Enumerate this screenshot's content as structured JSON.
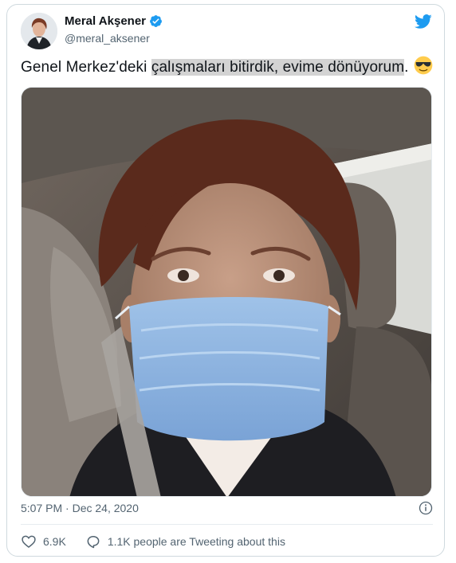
{
  "tweet": {
    "author_name": "Meral Akşener",
    "author_handle": "@meral_aksener",
    "text_before": "Genel Merkez'deki ",
    "text_highlight": "çalışmaları bitirdik, evime dönüyorum",
    "text_after": ".",
    "emoji": "smiling-face-with-sunglasses",
    "timestamp": "5:07 PM · Dec 24, 2020",
    "likes": "6.9K",
    "retweet_label": "1.1K people are Tweeting about this"
  },
  "colors": {
    "twitter_blue": "#1d9bf0",
    "text": "#0f1419",
    "secondary": "#536471",
    "border": "#cfd9de",
    "highlight": "#d3d3d3"
  }
}
